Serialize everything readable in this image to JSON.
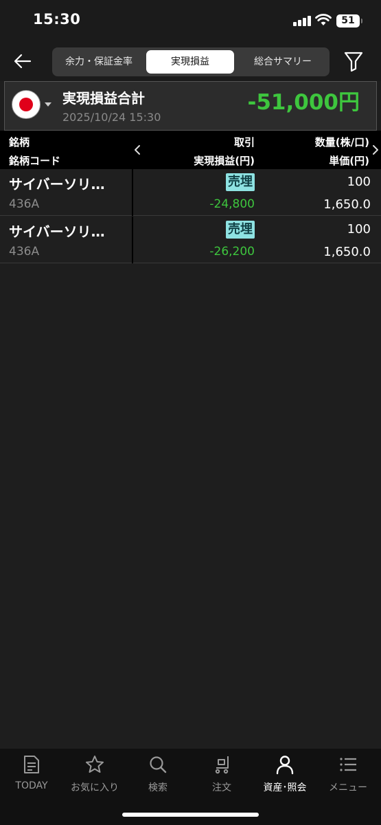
{
  "status_bar": {
    "time": "15:30",
    "battery": "51"
  },
  "nav": {
    "tabs": [
      {
        "label": "余力・保証金率",
        "active": false
      },
      {
        "label": "実現損益",
        "active": true
      },
      {
        "label": "総合サマリー",
        "active": false
      }
    ]
  },
  "summary": {
    "title": "実現損益合計",
    "datetime": "2025/10/24 15:30",
    "total": "-51,000円"
  },
  "table": {
    "headers": {
      "col1_line1": "銘柄",
      "col1_line2": "銘柄コード",
      "col2_line1": "取引",
      "col2_line2": "実現損益(円)",
      "col3_line1": "数量(株/口)",
      "col3_line2": "単価(円)"
    },
    "rows": [
      {
        "name": "サイバーソリ…",
        "code": "436A",
        "trade": "売埋",
        "realized": "-24,800",
        "qty": "100",
        "price": "1,650.0"
      },
      {
        "name": "サイバーソリ…",
        "code": "436A",
        "trade": "売埋",
        "realized": "-26,200",
        "qty": "100",
        "price": "1,650.0"
      }
    ]
  },
  "bottom_nav": [
    {
      "label": "TODAY",
      "icon": "news-icon"
    },
    {
      "label": "お気に入り",
      "icon": "star-icon"
    },
    {
      "label": "検索",
      "icon": "search-icon"
    },
    {
      "label": "注文",
      "icon": "cart-icon"
    },
    {
      "label": "資産･照会",
      "icon": "person-icon",
      "active": true
    },
    {
      "label": "メニュー",
      "icon": "menu-icon"
    }
  ],
  "colors": {
    "profit_loss": "#3ec63e",
    "trade_badge": "#8ee2e2",
    "background": "#1e1e1e"
  }
}
